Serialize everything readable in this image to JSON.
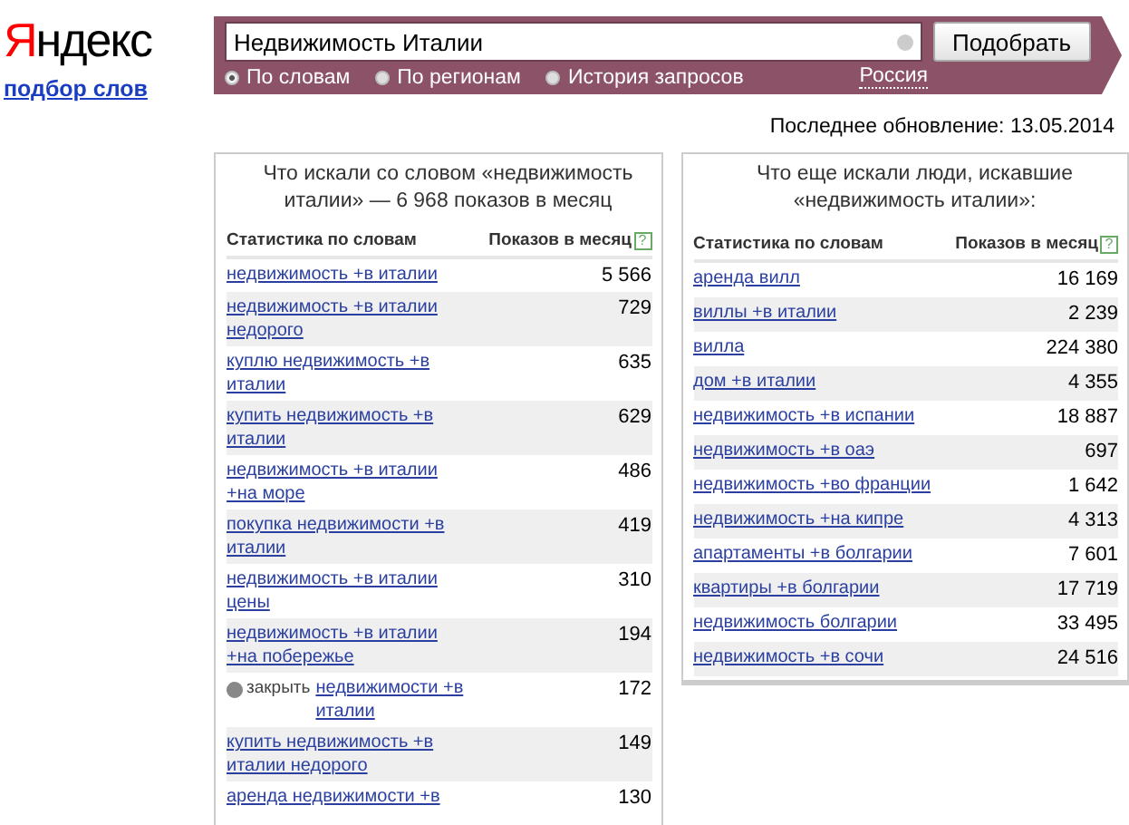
{
  "logo": {
    "text": "Яндекс",
    "subtitle": "подбор слов"
  },
  "search": {
    "value": "Недвижимость Италии",
    "button": "Подобрать",
    "modes": [
      {
        "label": "По словам",
        "selected": true
      },
      {
        "label": "По регионам",
        "selected": false
      },
      {
        "label": "История запросов",
        "selected": false
      }
    ],
    "region": "Россия"
  },
  "updated": "Последнее обновление: 13.05.2014",
  "panels": [
    {
      "title": "Что искали со словом «недвижимость италии» — 6 968 показов в месяц",
      "columns": [
        "Статистика по словам",
        "Показов в месяц"
      ],
      "help": "?",
      "rows": [
        {
          "keyword": "недвижимость +в италии",
          "count": "5 566"
        },
        {
          "keyword": "недвижимость +в италии недорого",
          "count": "729"
        },
        {
          "keyword": "куплю недвижимость +в италии",
          "count": "635"
        },
        {
          "keyword": "купить недвижимость +в италии",
          "count": "629"
        },
        {
          "keyword": "недвижимость +в италии +на море",
          "count": "486"
        },
        {
          "keyword": "покупка недвижимости +в италии",
          "count": "419"
        },
        {
          "keyword": "недвижимость +в италии цены",
          "count": "310"
        },
        {
          "keyword": "недвижимость +в италии +на побережье",
          "count": "194"
        },
        {
          "keyword": "недвижимости +в италии",
          "count": "172",
          "overlay": "закрыть"
        },
        {
          "keyword": "купить недвижимость +в италии недорого",
          "count": "149"
        },
        {
          "keyword": "аренда недвижимости +в",
          "count": "130"
        }
      ]
    },
    {
      "title": "Что еще искали люди, искавшие «недвижимость италии»:",
      "columns": [
        "Статистика по словам",
        "Показов в месяц"
      ],
      "help": "?",
      "rows": [
        {
          "keyword": "аренда вилл",
          "count": "16 169"
        },
        {
          "keyword": "виллы +в италии",
          "count": "2 239"
        },
        {
          "keyword": "вилла",
          "count": "224 380"
        },
        {
          "keyword": "дом +в италии",
          "count": "4 355"
        },
        {
          "keyword": "недвижимость +в испании",
          "count": "18 887"
        },
        {
          "keyword": "недвижимость +в оаэ",
          "count": "697"
        },
        {
          "keyword": "недвижимость +во франции",
          "count": "1 642"
        },
        {
          "keyword": "недвижимость +на кипре",
          "count": "4 313"
        },
        {
          "keyword": "апартаменты +в болгарии",
          "count": "7 601"
        },
        {
          "keyword": "квартиры +в болгарии",
          "count": "17 719"
        },
        {
          "keyword": "недвижимость болгарии",
          "count": "33 495"
        },
        {
          "keyword": "недвижимость +в сочи",
          "count": "24 516"
        }
      ]
    }
  ]
}
